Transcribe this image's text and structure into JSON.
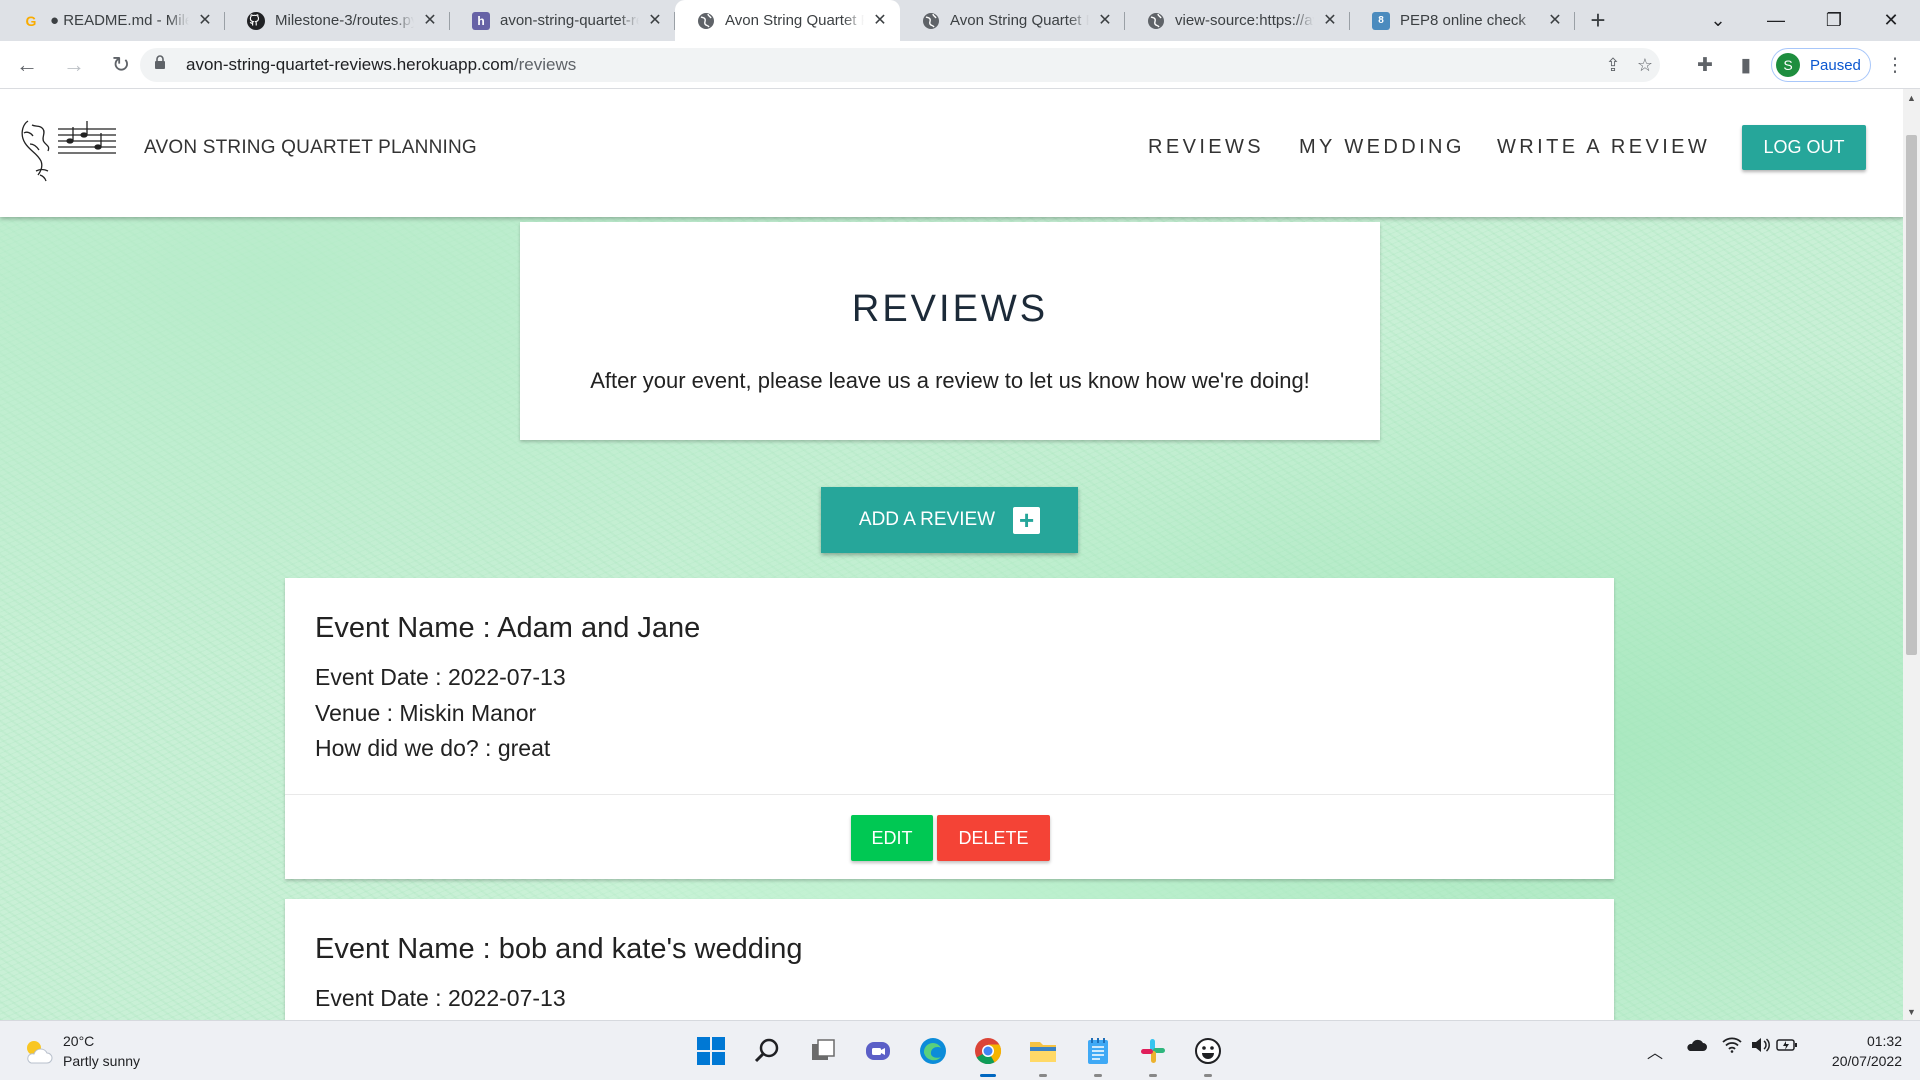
{
  "browser": {
    "tabs": [
      {
        "title": "● README.md - Milestone-3",
        "icon": "google-docs-icon",
        "color": "#f9ab00",
        "active": false
      },
      {
        "title": "Milestone-3/routes.py",
        "icon": "github-icon",
        "color": "#202124",
        "active": false
      },
      {
        "title": "avon-string-quartet-reviews",
        "icon": "heroku-icon",
        "color": "#6762a6",
        "active": false
      },
      {
        "title": "Avon String Quartet Planning",
        "icon": "globe-icon",
        "color": "#5f6368",
        "active": true
      },
      {
        "title": "Avon String Quartet Planning",
        "icon": "globe-icon",
        "color": "#5f6368",
        "active": false
      },
      {
        "title": "view-source:https://avon",
        "icon": "globe-icon",
        "color": "#5f6368",
        "active": false
      },
      {
        "title": "PEP8 online check",
        "icon": "pep8-icon",
        "color": "#4b8bbe",
        "active": false
      }
    ],
    "url_host": "avon-string-quartet-reviews.herokuapp.com",
    "url_path": "/reviews",
    "profile_initial": "S",
    "profile_status": "Paused"
  },
  "site": {
    "brand": "AVON STRING QUARTET PLANNING",
    "nav": [
      "REVIEWS",
      "MY WEDDING",
      "WRITE A REVIEW"
    ],
    "logout_label": "LOG OUT",
    "accent": "#26a69a"
  },
  "main": {
    "title": "REVIEWS",
    "subtitle": "After your event, please leave us a review to let us know how we're doing!",
    "add_label": "ADD A REVIEW"
  },
  "reviews": [
    {
      "event_name": "Event Name : Adam and Jane",
      "event_date": "Event Date : 2022-07-13",
      "venue": "Venue : Miskin Manor",
      "feedback": "How did we do? : great",
      "edit_label": "EDIT",
      "delete_label": "DELETE"
    },
    {
      "event_name": "Event Name : bob and kate's wedding",
      "event_date": "Event Date : 2022-07-13"
    }
  ],
  "taskbar": {
    "temperature": "20°C",
    "weather": "Partly sunny",
    "time": "01:32",
    "date": "20/07/2022"
  }
}
